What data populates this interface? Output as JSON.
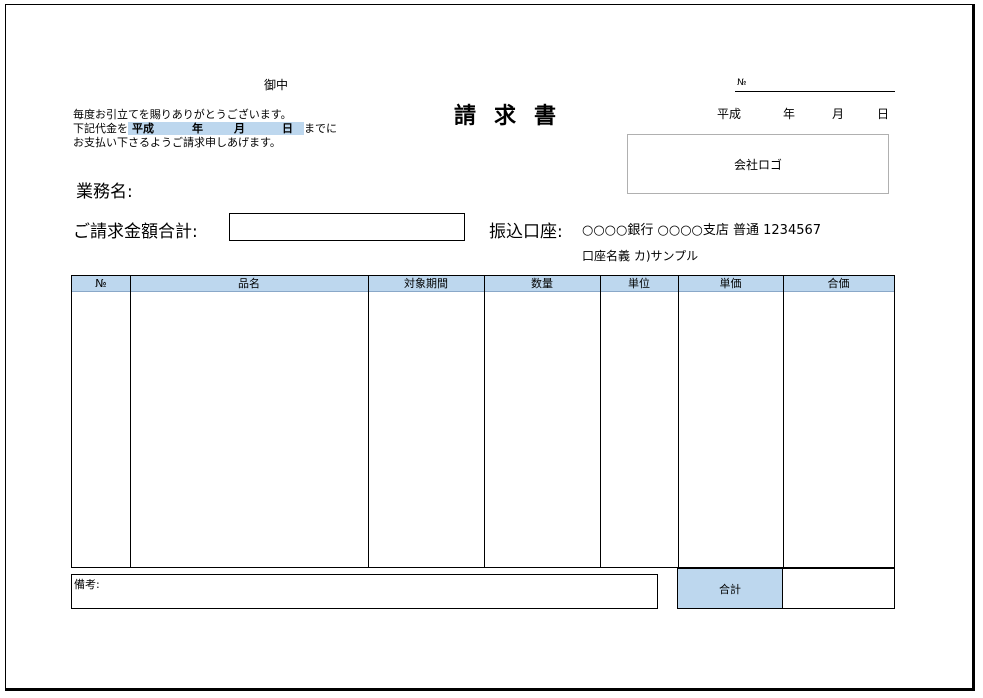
{
  "header": {
    "addressee_suffix": "御中",
    "title": "請求書",
    "number_label": "№",
    "date": {
      "era": "平成",
      "year": "年",
      "month": "月",
      "day": "日"
    },
    "logo_text": "会社ロゴ"
  },
  "greeting": {
    "line1": "毎度お引立てを賜りありがとうございます。",
    "line2_prefix": "下記代金を",
    "due": {
      "era": "平成",
      "year": "年",
      "month": "月",
      "day": "日"
    },
    "line2_suffix": "までに",
    "line3": "お支払い下さるようご請求申しあげます。"
  },
  "business_name_label": "業務名:",
  "amount_total_label": "ご請求金額合計:",
  "bank": {
    "label": "振込口座:",
    "info": "○○○○銀行  ○○○○支店  普通  1234567",
    "account_holder": "口座名義  カ)サンプル"
  },
  "table": {
    "columns": [
      "№",
      "品名",
      "対象期間",
      "数量",
      "単位",
      "単価",
      "合価"
    ]
  },
  "footer": {
    "remarks_label": "備考:",
    "total_label": "合計"
  },
  "colors": {
    "header_fill": "#bdd7ee",
    "border": "#000000"
  }
}
